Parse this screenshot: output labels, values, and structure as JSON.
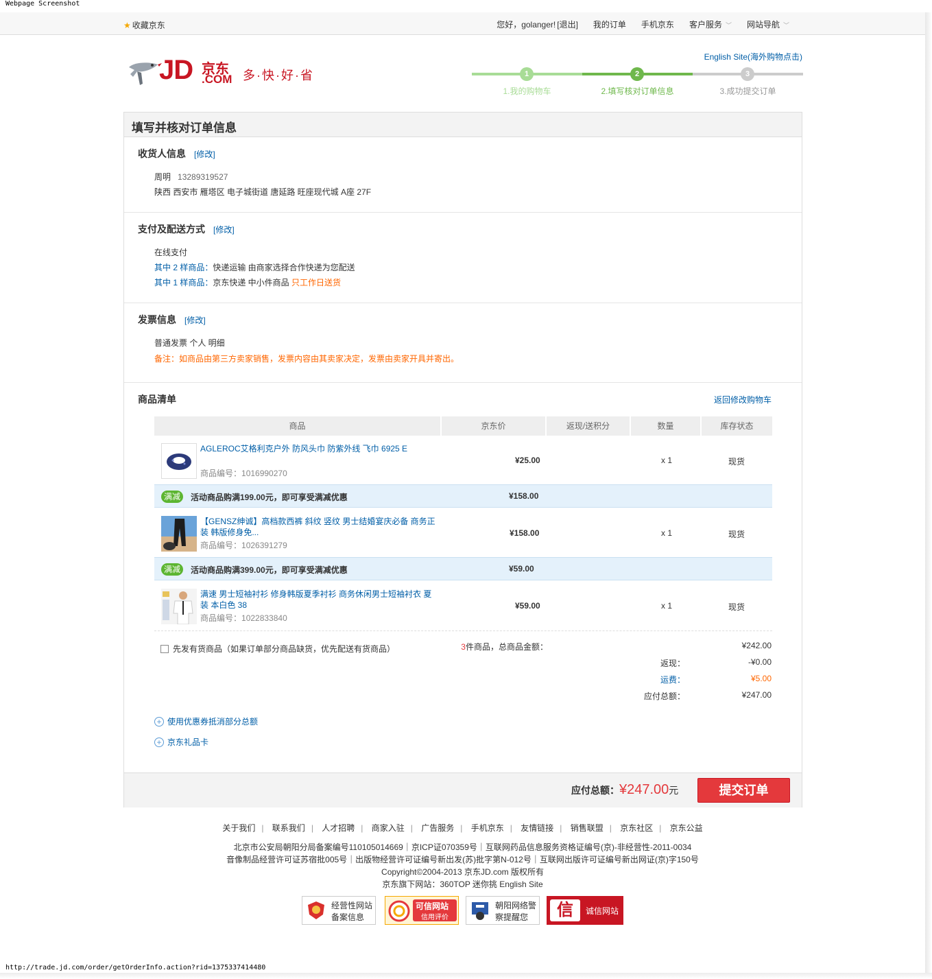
{
  "captions": {
    "top": "Webpage Screenshot",
    "bottom": "http://trade.jd.com/order/getOrderInfo.action?rid=1375337414480"
  },
  "topbar": {
    "favorite": "收藏京东",
    "greeting": "您好，golanger!",
    "logout": "[退出]",
    "my_orders": "我的订单",
    "mobile_jd": "手机京东",
    "customer_service": "客户服务",
    "site_nav": "网站导航"
  },
  "header": {
    "logo_jd": "JD",
    "logo_cn": "京东",
    "logo_com": ".COM",
    "slogan": "多·快·好·省",
    "english_site": "English Site(海外购物点击)"
  },
  "steps": [
    {
      "num": "1",
      "label": "1.我的购物车",
      "state": "done"
    },
    {
      "num": "2",
      "label": "2.填写核对订单信息",
      "state": "current"
    },
    {
      "num": "3",
      "label": "3.成功提交订单",
      "state": "todo"
    }
  ],
  "colors": {
    "brand_red": "#e4393c",
    "link_blue": "#005ea7",
    "step_done": "#a8dc96",
    "step_current": "#6fb84c",
    "step_todo": "#cccccc",
    "promo_green": "#5cb531"
  },
  "main": {
    "title": "填写并核对订单信息",
    "modify": "[修改]",
    "consignee": {
      "heading": "收货人信息",
      "name": "周明",
      "phone": "13289319527",
      "address": "陕西 西安市 雁塔区 电子城街道  唐延路 旺座现代城 A座 27F"
    },
    "payment": {
      "heading": "支付及配送方式",
      "method": "在线支付",
      "line1_prefix": "其中 2 样商品：",
      "line1_text": "快递运输  由商家选择合作快递为您配送",
      "line2_prefix": "其中 1 样商品：",
      "line2_text": "京东快递  中小件商品 ",
      "line2_highlight": "只工作日送货"
    },
    "invoice": {
      "heading": "发票信息",
      "info": "普通发票  个人  明细",
      "note": "备注：如商品由第三方卖家销售，发票内容由其卖家决定，发票由卖家开具并寄出。"
    },
    "products": {
      "heading": "商品清单",
      "back_link": "返回修改购物车",
      "columns": [
        "商品",
        "京东价",
        "返现/送积分",
        "数量",
        "库存状态"
      ],
      "items": [
        {
          "name": "AGLEROC艾格利克户外 防风头巾 防紫外线 飞巾 6925 E",
          "sku_label": "商品编号：",
          "sku": "1016990270",
          "price": "¥25.00",
          "qty": "x 1",
          "stock": "现货"
        },
        {
          "name": "【GENSZ绅诚】高档款西裤 斜纹 竖纹 男士结婚宴庆必备 商务正装 韩版修身免...",
          "sku_label": "商品编号：",
          "sku": "1026391279",
          "price": "¥158.00",
          "qty": "x 1",
          "stock": "现货"
        },
        {
          "name": "满速 男士短袖衬衫 修身韩版夏季衬衫 商务休闲男士短袖衬衣 夏装 本白色 38",
          "sku_label": "商品编号：",
          "sku": "1022833840",
          "price": "¥59.00",
          "qty": "x 1",
          "stock": "现货"
        }
      ],
      "promos": [
        {
          "badge": "满减",
          "text": "活动商品购满199.00元，即可享受满减优惠",
          "price": "¥158.00"
        },
        {
          "badge": "满减",
          "text": "活动商品购满399.00元，即可享受满减优惠",
          "price": "¥59.00"
        }
      ]
    },
    "summary": {
      "ship_first": "先发有货商品（如果订单部分商品缺货，优先配送有货商品）",
      "count": "3",
      "count_label": "件商品，总商品金额：",
      "total_goods": "¥242.00",
      "cashback_label": "返现：",
      "cashback": "-¥0.00",
      "shipping_label": "运费：",
      "shipping": "¥5.00",
      "payable_label": "应付总额：",
      "payable": "¥247.00"
    },
    "coupon": "使用优惠券抵消部分总额",
    "giftcard": "京东礼品卡",
    "footer_bar": {
      "label": "应付总额：",
      "amount": "¥247.00",
      "unit": "元",
      "submit": "提交订单"
    }
  },
  "footer": {
    "links": [
      "关于我们",
      "联系我们",
      "人才招聘",
      "商家入驻",
      "广告服务",
      "手机京东",
      "友情链接",
      "销售联盟",
      "京东社区",
      "京东公益"
    ],
    "license1": "北京市公安局朝阳分局备案编号110105014669｜京ICP证070359号｜互联网药品信息服务资格证编号(京)-非经营性-2011-0034",
    "license2": "音像制品经营许可证苏宿批005号｜出版物经营许可证编号新出发(苏)批字第N-012号｜互联网出版许可证编号新出网证(京)字150号",
    "copyright": "Copyright©2004-2013  京东JD.com 版权所有",
    "sites": "京东旗下网站：360TOP  迷你挑  English Site",
    "badges": [
      {
        "line1": "经营性网站",
        "line2": "备案信息"
      },
      {
        "line1": "可信网站",
        "line2": "信用评价"
      },
      {
        "line1": "朝阳网络警",
        "line2": "察提醒您"
      },
      {
        "line1": "诚信网站",
        "line2": ""
      }
    ]
  }
}
